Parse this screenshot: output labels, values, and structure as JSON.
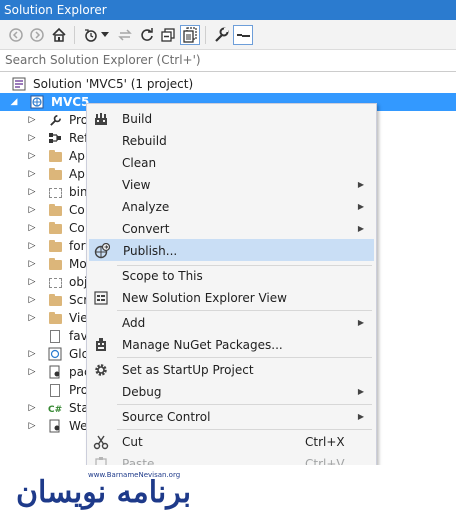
{
  "window": {
    "title": "Solution Explorer"
  },
  "toolbar": {
    "buttons": [
      "back-icon",
      "forward-icon",
      "home-icon",
      "history-icon",
      "dropdown-icon",
      "sync-icon",
      "refresh-icon",
      "collapse-all-icon",
      "show-all-files-icon",
      "properties-icon",
      "preview-icon"
    ]
  },
  "search": {
    "placeholder": "Search Solution Explorer (Ctrl+')"
  },
  "tree": {
    "solution_label": "Solution 'MVC5' (1 project)",
    "project_label": "MVC5",
    "items": [
      {
        "label": "Pro",
        "icon": "wrench-icon"
      },
      {
        "label": "Ref",
        "icon": "references-icon"
      },
      {
        "label": "Ap",
        "icon": "folder-icon"
      },
      {
        "label": "Ap",
        "icon": "folder-icon"
      },
      {
        "label": "bin",
        "icon": "hidden-folder-icon"
      },
      {
        "label": "Co",
        "icon": "folder-icon"
      },
      {
        "label": "Co",
        "icon": "folder-icon"
      },
      {
        "label": "for",
        "icon": "folder-icon"
      },
      {
        "label": "Mo",
        "icon": "folder-icon"
      },
      {
        "label": "obj",
        "icon": "hidden-folder-icon"
      },
      {
        "label": "Scr",
        "icon": "folder-icon"
      },
      {
        "label": "Vie",
        "icon": "folder-icon"
      },
      {
        "label": "fav",
        "icon": "file-icon"
      },
      {
        "label": "Glo",
        "icon": "globe-icon"
      },
      {
        "label": "pac",
        "icon": "config-icon"
      },
      {
        "label": "Pro",
        "icon": "file-icon"
      },
      {
        "label": "Sta",
        "icon": "csharp-icon"
      },
      {
        "label": "We",
        "icon": "config-icon"
      }
    ]
  },
  "context_menu": {
    "build": "Build",
    "rebuild": "Rebuild",
    "clean": "Clean",
    "view": "View",
    "analyze": "Analyze",
    "convert": "Convert",
    "publish": "Publish...",
    "scope_to_this": "Scope to This",
    "new_solution_explorer_view": "New Solution Explorer View",
    "add": "Add",
    "manage_nuget": "Manage NuGet Packages...",
    "set_startup": "Set as StartUp Project",
    "debug": "Debug",
    "source_control": "Source Control",
    "cut": "Cut",
    "cut_shortcut": "Ctrl+X",
    "paste": "Paste",
    "paste_shortcut": "Ctrl+V"
  },
  "watermark": {
    "logo": "برنامه نویسان",
    "url": "www.BarnameNevisan.org"
  },
  "colors": {
    "accent": "#2b7bcf",
    "selection": "#3399ff",
    "menu_hover": "#c9def5",
    "folder": "#dcb67a"
  }
}
